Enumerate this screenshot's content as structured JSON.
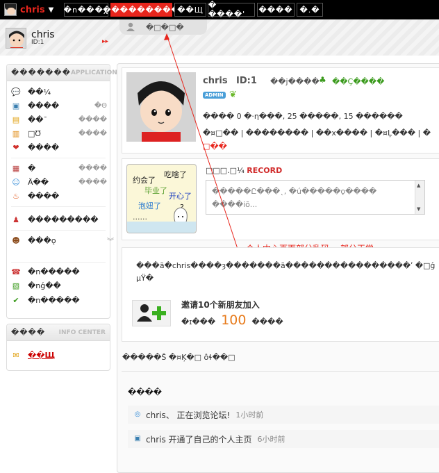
{
  "topbar": {
    "username": "chris",
    "buttons": [
      "�n���χ",
      "���������",
      "��Щ",
      "� ����'",
      "����",
      "�.�"
    ]
  },
  "header": {
    "name": "chris",
    "id": "ID:1",
    "arrows": "▸▸",
    "tab_label": "�□�□�"
  },
  "sidebar_app": {
    "title": "�������",
    "title_en": "APPLICATION",
    "items": [
      {
        "label": "��¼",
        "extra": ""
      },
      {
        "label": "����",
        "extra": "�Θ"
      },
      {
        "label": "��ˉ",
        "extra": "����"
      },
      {
        "label": "□Ʊ",
        "extra": "����"
      },
      {
        "label": "����",
        "extra": ""
      },
      {
        "label": "�",
        "extra": "����"
      },
      {
        "label": "Ä��",
        "extra": "����"
      },
      {
        "label": "����",
        "extra": ""
      },
      {
        "label": "���������",
        "extra": ""
      },
      {
        "label": "���ǫ",
        "extra": ""
      },
      {
        "label": "�n�����",
        "extra": ""
      },
      {
        "label": "�nǵ��",
        "extra": ""
      },
      {
        "label": "�n�����",
        "extra": ""
      }
    ]
  },
  "sidebar_info": {
    "title": "����",
    "title_en": "INFO CENTER",
    "link": "��Щ"
  },
  "profile": {
    "name": "chris",
    "id": "ID:1",
    "status_a": "��j����",
    "status_b": "��Ç����",
    "badge": "ADMIN",
    "stats": "���� 0 �·η���, 25 �����, 15 ������",
    "links": "�¤□�� | �������� | ��x���� | �¤Ļ��� | �",
    "more": "□��"
  },
  "record": {
    "title": "□□□.□¼",
    "title_en": "RECORD",
    "placeholder": "�����Ը���˛, �ú�����ǫ���� ����iõ...",
    "doodle": [
      "约会了",
      "吃啥了",
      "毕业了",
      "开心了",
      "泡妞了",
      "? ",
      "......"
    ]
  },
  "annotation": "个人中心页面部分乱码， 部分正常",
  "invite": {
    "text": "���ã�chris����ȝ�������ã����������������ʹ �□ǵ",
    "text2": "µŸ�",
    "title": "邀请10个新朋友加入",
    "prefix": "�ɪ���",
    "count": "100",
    "suffix": "����"
  },
  "feed": {
    "header": "�����Š �¤Ķ�□ ôɬ��□",
    "subheader": "����",
    "items": [
      {
        "icon": "browse-icon",
        "text": "chris、 正在浏览论坛!",
        "time": "1小时前"
      },
      {
        "icon": "profile-card-icon",
        "text": "chris 开通了自己的个人主页",
        "time": "6小时前"
      }
    ]
  },
  "colors": {
    "accent": "#e8251c",
    "topbar": "#000000",
    "link": "#3a9a1c",
    "count": "#e77a1a"
  }
}
